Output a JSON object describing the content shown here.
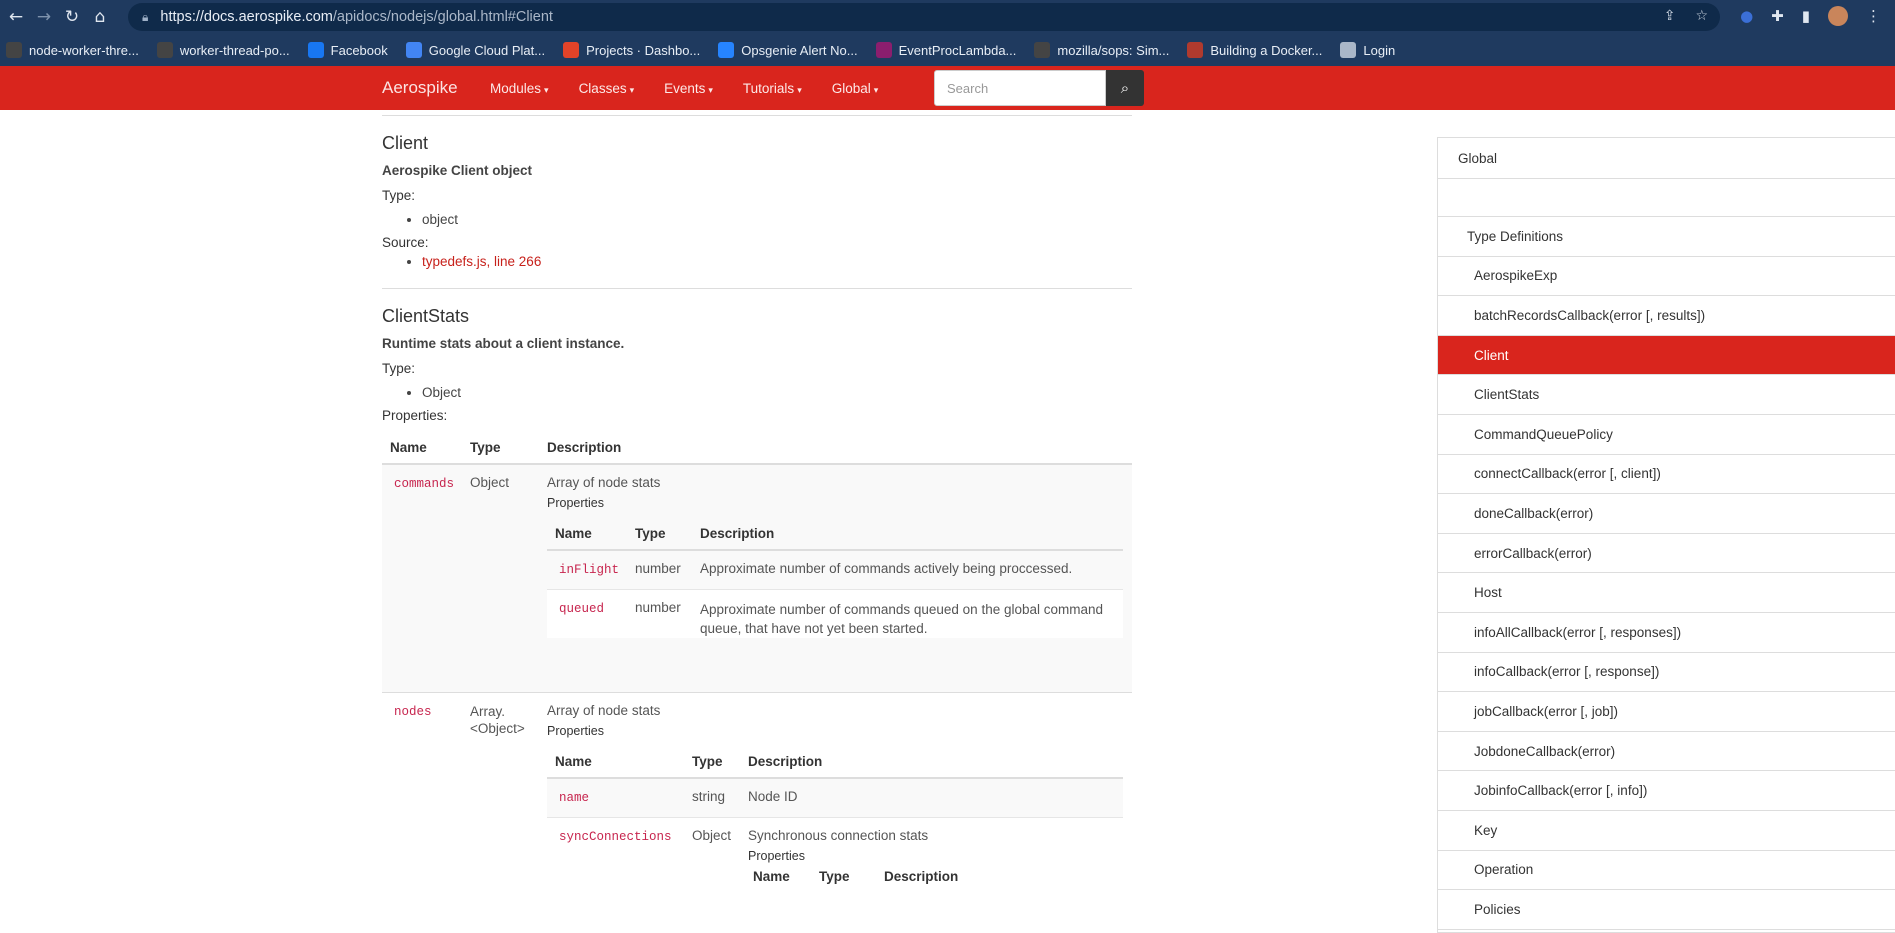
{
  "browser": {
    "url_host": "https://docs.aerospike.com",
    "url_path": "/apidocs/nodejs/global.html#Client",
    "bookmarks": [
      {
        "label": "node-worker-thre...",
        "color": "#444"
      },
      {
        "label": "worker-thread-po...",
        "color": "#444"
      },
      {
        "label": "Facebook",
        "color": "#1877f2"
      },
      {
        "label": "Google Cloud Plat...",
        "color": "#4285f4"
      },
      {
        "label": "Projects · Dashbo...",
        "color": "#e24329"
      },
      {
        "label": "Opsgenie Alert No...",
        "color": "#2684ff"
      },
      {
        "label": "EventProcLambda...",
        "color": "#8b1e6e"
      },
      {
        "label": "mozilla/sops: Sim...",
        "color": "#444"
      },
      {
        "label": "Building a Docker...",
        "color": "#b03a2e"
      },
      {
        "label": "Login",
        "color": "#aab7c8"
      }
    ]
  },
  "navbar": {
    "brand": "Aerospike",
    "menu": [
      "Modules",
      "Classes",
      "Events",
      "Tutorials",
      "Global"
    ],
    "search_placeholder": "Search"
  },
  "client": {
    "title": "Client",
    "description": "Aerospike Client object",
    "type_label": "Type:",
    "type_value": "object",
    "source_label": "Source:",
    "source_link": "typedefs.js, line 266"
  },
  "clientstats": {
    "title": "ClientStats",
    "description": "Runtime stats about a client instance.",
    "type_label": "Type:",
    "type_value": "Object",
    "properties_label": "Properties:",
    "headers": [
      "Name",
      "Type",
      "Description"
    ],
    "sub_properties_label": "Properties",
    "commands": {
      "name": "commands",
      "type": "Object",
      "description": "Array of node stats",
      "rows": [
        {
          "name": "inFlight",
          "type": "number",
          "description": "Approximate number of commands actively being proccessed."
        },
        {
          "name": "queued",
          "type": "number",
          "description": "Approximate number of commands queued on the global command queue, that have not yet been started."
        }
      ]
    },
    "nodes": {
      "name": "nodes",
      "type_line1": "Array.",
      "type_line2": "<Object>",
      "description": "Array of node stats",
      "rows": [
        {
          "name": "name",
          "type": "string",
          "description": "Node ID"
        },
        {
          "name": "syncConnections",
          "type": "Object",
          "description": "Synchronous connection stats"
        }
      ]
    }
  },
  "sidebar": {
    "items": [
      "Global",
      "",
      "Type Definitions",
      "AerospikeExp",
      "batchRecordsCallback(error [, results])",
      "Client",
      "ClientStats",
      "CommandQueuePolicy",
      "connectCallback(error [, client])",
      "doneCallback(error)",
      "errorCallback(error)",
      "Host",
      "infoAllCallback(error [, responses])",
      "infoCallback(error [, response])",
      "jobCallback(error [, job])",
      "JobdoneCallback(error)",
      "JobinfoCallback(error [, info])",
      "Key",
      "Operation",
      "Policies"
    ],
    "active": "Client"
  }
}
